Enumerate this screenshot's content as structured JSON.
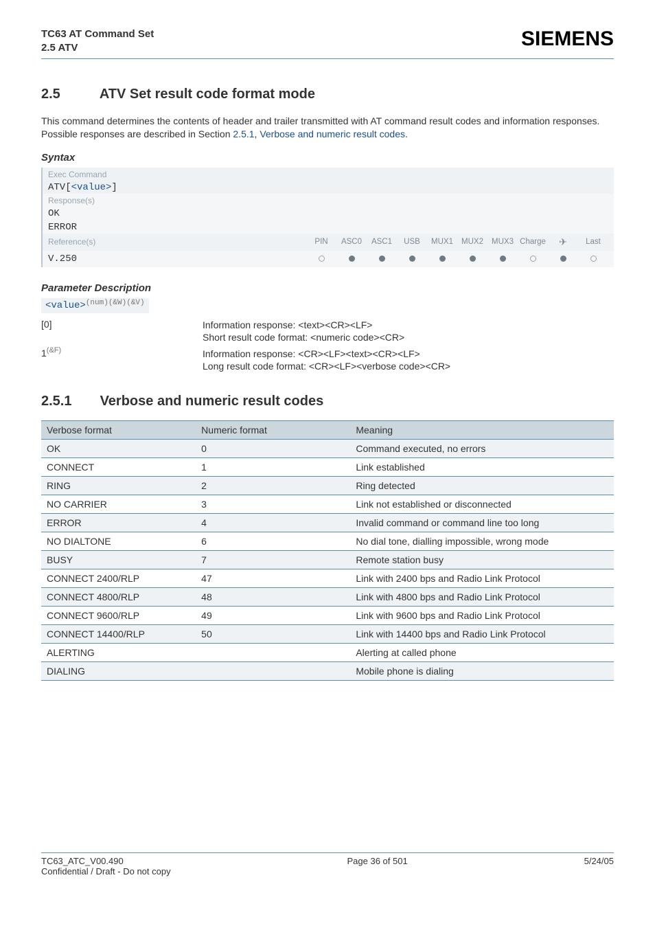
{
  "header": {
    "title": "TC63 AT Command Set",
    "subtitle": "2.5 ATV",
    "brand": "SIEMENS"
  },
  "section": {
    "num": "2.5",
    "title": "ATV   Set result code format mode",
    "body1": "This command determines the contents of header and trailer transmitted with AT command result codes and information responses. Possible responses are described in Section ",
    "link1": "2.5.1",
    "sep": ", ",
    "link2": "Verbose and numeric result codes",
    "tail": "."
  },
  "syntax": {
    "heading": "Syntax",
    "exec_label": "Exec Command",
    "exec_cmd_pre": "ATV[",
    "exec_cmd_val": "<value>",
    "exec_cmd_post": "]",
    "resp_label": "Response(s)",
    "resp1": "OK",
    "resp2": "ERROR",
    "ref_label": "Reference(s)",
    "cols": [
      "PIN",
      "ASC0",
      "ASC1",
      "USB",
      "MUX1",
      "MUX2",
      "MUX3",
      "Charge",
      "",
      "Last"
    ],
    "plane": "✈",
    "ref_value": "V.250",
    "dots": [
      "open",
      "fill",
      "fill",
      "fill",
      "fill",
      "fill",
      "fill",
      "open",
      "fill",
      "open"
    ]
  },
  "params": {
    "heading": "Parameter Description",
    "tag": "<value>",
    "tag_sup": "(num)(&W)(&V)",
    "rows": [
      {
        "key": "[0]",
        "d1": "Information response: <text><CR><LF>",
        "d2": "Short result code format: <numeric code><CR>"
      },
      {
        "key_pre": "1",
        "key_sup": "(&F)",
        "d1": "Information response: <CR><LF><text><CR><LF>",
        "d2": "Long result code format: <CR><LF><verbose code><CR>"
      }
    ]
  },
  "subsection": {
    "num": "2.5.1",
    "title": "Verbose and numeric result codes"
  },
  "results": {
    "headers": [
      "Verbose format",
      "Numeric format",
      "Meaning"
    ],
    "rows": [
      {
        "v": "OK",
        "n": "0",
        "m": "Command executed, no errors"
      },
      {
        "v": "CONNECT",
        "n": "1",
        "m": "Link established"
      },
      {
        "v": "RING",
        "n": "2",
        "m": "Ring detected"
      },
      {
        "v": "NO CARRIER",
        "n": "3",
        "m": "Link not established or disconnected"
      },
      {
        "v": "ERROR",
        "n": "4",
        "m": "Invalid command or command line too long"
      },
      {
        "v": "NO DIALTONE",
        "n": "6",
        "m": "No dial tone, dialling impossible, wrong mode"
      },
      {
        "v": "BUSY",
        "n": "7",
        "m": "Remote station busy"
      },
      {
        "v": "CONNECT 2400/RLP",
        "n": "47",
        "m": "Link with 2400 bps and Radio Link Protocol"
      },
      {
        "v": "CONNECT 4800/RLP",
        "n": "48",
        "m": "Link with 4800 bps and Radio Link Protocol"
      },
      {
        "v": "CONNECT 9600/RLP",
        "n": "49",
        "m": "Link with 9600 bps and Radio Link Protocol"
      },
      {
        "v": "CONNECT 14400/RLP",
        "n": "50",
        "m": "Link with 14400 bps and Radio Link Protocol"
      },
      {
        "v": "ALERTING",
        "n": "",
        "m": "Alerting at called phone"
      },
      {
        "v": "DIALING",
        "n": "",
        "m": "Mobile phone is dialing"
      }
    ]
  },
  "footer": {
    "left1": "TC63_ATC_V00.490",
    "left2": "Confidential / Draft - Do not copy",
    "center": "Page 36 of 501",
    "right": "5/24/05"
  }
}
